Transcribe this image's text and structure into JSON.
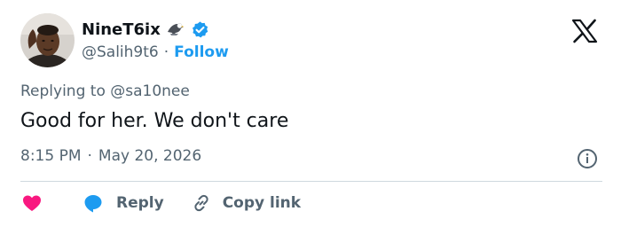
{
  "author": {
    "display_name": "NineT6ix",
    "handle": "@Salih9t6",
    "separator": "·",
    "follow_label": "Follow",
    "avatar_icon": "avatar-photo",
    "badge_emoji_icon": "eagle-icon",
    "verified_icon": "verified-badge-icon"
  },
  "platform_icon": "x-logo-icon",
  "replying_to": "Replying to @sa10nee",
  "tweet_text": "Good for her. We don't care",
  "timestamp": {
    "time": "8:15 PM",
    "separator": "·",
    "date": "May 20, 2026"
  },
  "actions": {
    "like_icon": "heart-icon",
    "reply_label": "Reply",
    "copy_label": "Copy link"
  },
  "colors": {
    "accent": "#1d9bf0",
    "like": "#f91880",
    "text": "#0f1419",
    "secondary": "#536471",
    "divider": "#cfd9de"
  }
}
